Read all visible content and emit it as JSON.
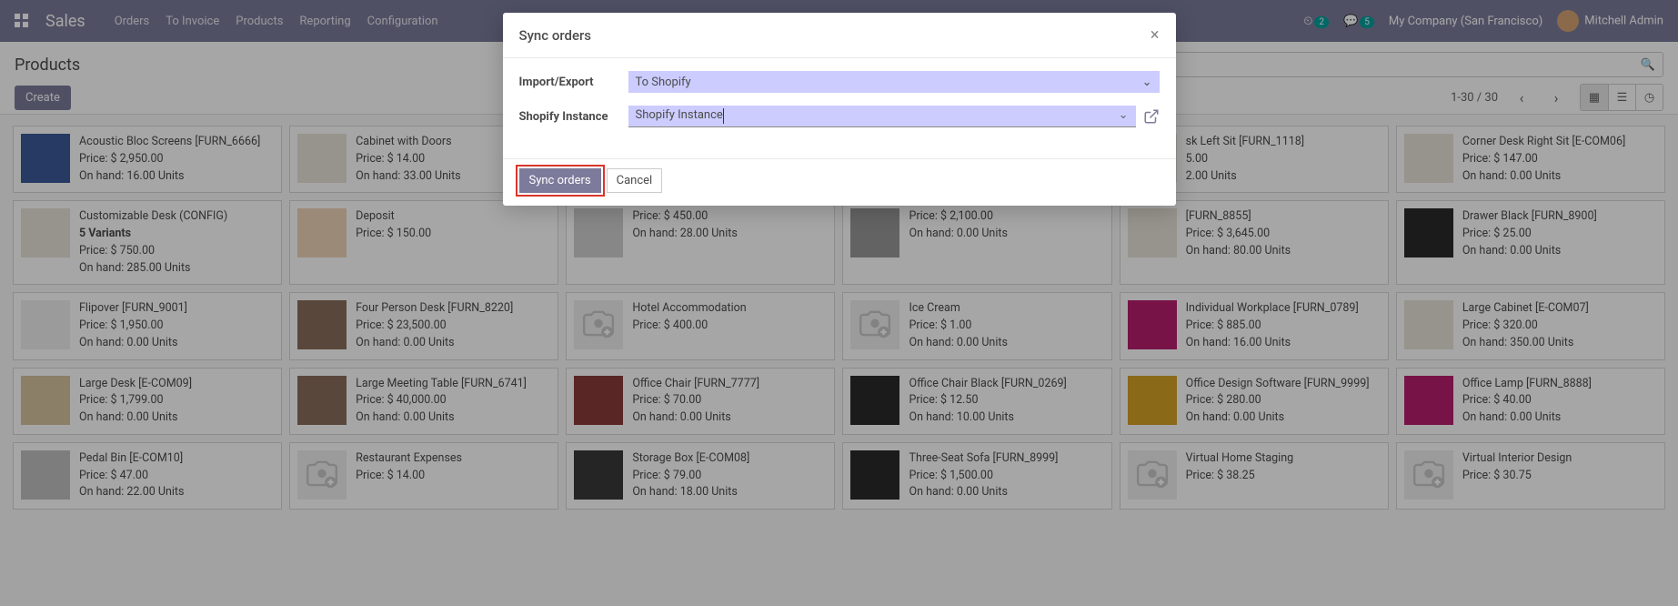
{
  "nav": {
    "brand": "Sales",
    "menu": [
      "Orders",
      "To Invoice",
      "Products",
      "Reporting",
      "Configuration"
    ],
    "sched_badge": "2",
    "msg_badge": "5",
    "company": "My Company (San Francisco)",
    "user": "Mitchell Admin"
  },
  "control": {
    "breadcrumb": "Products",
    "create": "Create",
    "pager": "1-30 / 30"
  },
  "modal": {
    "title": "Sync orders",
    "label_ie": "Import/Export",
    "value_ie": "To Shopify",
    "label_inst": "Shopify Instance",
    "value_inst": "Shopify Instance",
    "btn_primary": "Sync orders",
    "btn_cancel": "Cancel"
  },
  "products": [
    {
      "name": "Acoustic Bloc Screens [FURN_6666]",
      "price": "Price: $ 2,950.00",
      "onhand": "On hand: 16.00 Units",
      "color": "#3b5998"
    },
    {
      "name": "Cabinet with Doors",
      "price": "Price: $ 14.00",
      "onhand": "On hand: 33.00 Units",
      "color": "#e8e4d9"
    },
    {
      "name": "",
      "price": "",
      "onhand": "",
      "color": "#d8c4a0",
      "hidden": true
    },
    {
      "name": "",
      "price": "",
      "onhand": "",
      "color": "#cfcfcf",
      "hidden": true
    },
    {
      "name": "sk Left Sit [FURN_1118]",
      "price": "5.00",
      "onhand": "2.00 Units",
      "color": "#e8e4d9"
    },
    {
      "name": "Corner Desk Right Sit [E-COM06]",
      "price": "Price: $ 147.00",
      "onhand": "On hand: 0.00 Units",
      "color": "#e8e4d9"
    },
    {
      "name": "Customizable Desk (CONFIG)",
      "variants": "5 Variants",
      "price": "Price: $ 750.00",
      "onhand": "On hand: 285.00 Units",
      "color": "#e8e4d9"
    },
    {
      "name": "Deposit",
      "price": "Price: $ 150.00",
      "onhand": "",
      "color": "#f0d4b8"
    },
    {
      "name": "",
      "price": "Price: $ 450.00",
      "onhand": "On hand: 28.00 Units",
      "color": "#cfcfcf",
      "partial": true
    },
    {
      "name": "",
      "price": "Price: $ 2,100.00",
      "onhand": "On hand: 0.00 Units",
      "color": "#999",
      "partial": true
    },
    {
      "name": "[FURN_8855]",
      "price": "Price: $ 3,645.00",
      "onhand": "On hand: 80.00 Units",
      "color": "#e8e4d9"
    },
    {
      "name": "Drawer Black [FURN_8900]",
      "price": "Price: $ 25.00",
      "onhand": "On hand: 0.00 Units",
      "color": "#2a2a2a"
    },
    {
      "name": "Flipover [FURN_9001]",
      "price": "Price: $ 1,950.00",
      "onhand": "On hand: 0.00 Units",
      "color": "#eee"
    },
    {
      "name": "Four Person Desk [FURN_8220]",
      "price": "Price: $ 23,500.00",
      "onhand": "On hand: 0.00 Units",
      "color": "#8a6d5b"
    },
    {
      "name": "Hotel Accommodation",
      "price": "Price: $ 400.00",
      "onhand": "",
      "color": "placeholder"
    },
    {
      "name": "Ice Cream",
      "price": "Price: $ 1.00",
      "onhand": "On hand: 0.00 Units",
      "color": "placeholder"
    },
    {
      "name": "Individual Workplace [FURN_0789]",
      "price": "Price: $ 885.00",
      "onhand": "On hand: 16.00 Units",
      "color": "#b81e6f"
    },
    {
      "name": "Large Cabinet [E-COM07]",
      "price": "Price: $ 320.00",
      "onhand": "On hand: 350.00 Units",
      "color": "#e8e4d9"
    },
    {
      "name": "Large Desk [E-COM09]",
      "price": "Price: $ 1,799.00",
      "onhand": "On hand: 0.00 Units",
      "color": "#d8c4a0"
    },
    {
      "name": "Large Meeting Table [FURN_6741]",
      "price": "Price: $ 40,000.00",
      "onhand": "On hand: 0.00 Units",
      "color": "#8a6d5b"
    },
    {
      "name": "Office Chair [FURN_7777]",
      "price": "Price: $ 70.00",
      "onhand": "On hand: 0.00 Units",
      "color": "#8a3a3a"
    },
    {
      "name": "Office Chair Black [FURN_0269]",
      "price": "Price: $ 12.50",
      "onhand": "On hand: 10.00 Units",
      "color": "#2a2a2a"
    },
    {
      "name": "Office Design Software [FURN_9999]",
      "price": "Price: $ 280.00",
      "onhand": "On hand: 0.00 Units",
      "color": "#d4a225"
    },
    {
      "name": "Office Lamp [FURN_8888]",
      "price": "Price: $ 40.00",
      "onhand": "On hand: 0.00 Units",
      "color": "#b81e6f"
    },
    {
      "name": "Pedal Bin [E-COM10]",
      "price": "Price: $ 47.00",
      "onhand": "On hand: 22.00 Units",
      "color": "#c0c0c0"
    },
    {
      "name": "Restaurant Expenses",
      "price": "Price: $ 14.00",
      "onhand": "",
      "color": "placeholder"
    },
    {
      "name": "Storage Box [E-COM08]",
      "price": "Price: $ 79.00",
      "onhand": "On hand: 18.00 Units",
      "color": "#3a3a3a"
    },
    {
      "name": "Three-Seat Sofa [FURN_8999]",
      "price": "Price: $ 1,500.00",
      "onhand": "On hand: 0.00 Units",
      "color": "#2a2a2a"
    },
    {
      "name": "Virtual Home Staging",
      "price": "Price: $ 38.25",
      "onhand": "",
      "color": "placeholder"
    },
    {
      "name": "Virtual Interior Design",
      "price": "Price: $ 30.75",
      "onhand": "",
      "color": "placeholder"
    }
  ]
}
